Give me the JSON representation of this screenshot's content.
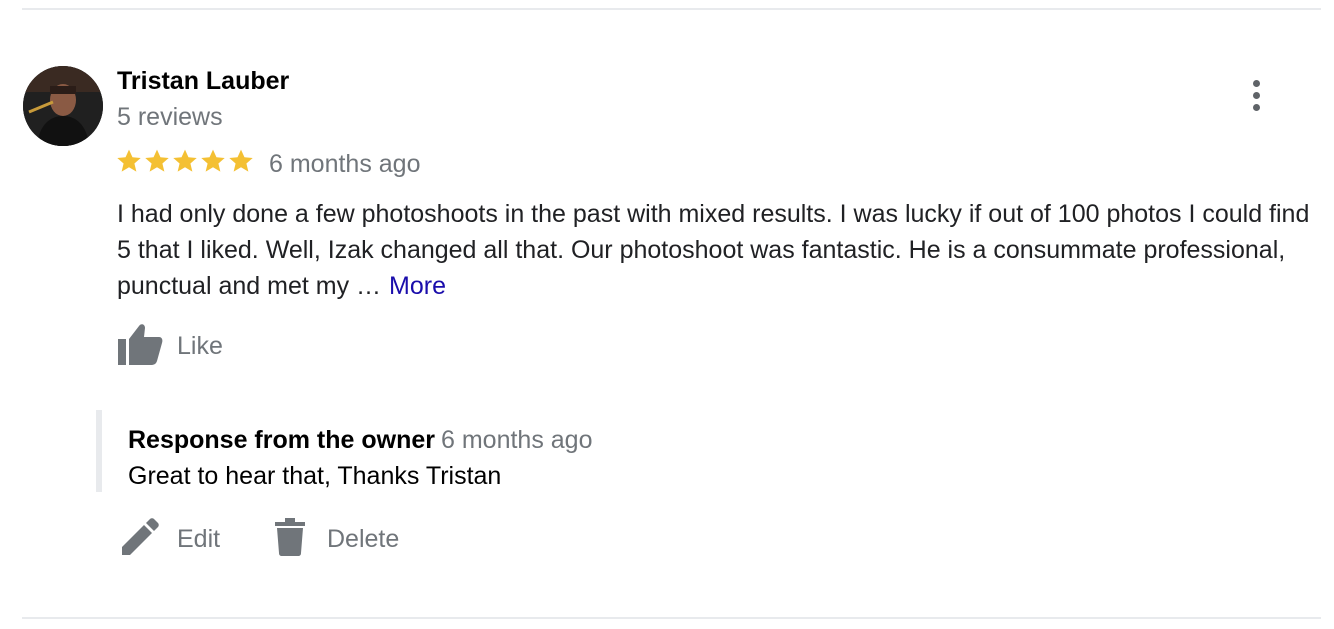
{
  "review": {
    "author_name": "Tristan Lauber",
    "author_reviews": "5 reviews",
    "rating": 5,
    "rating_max": 5,
    "date": "6 months ago",
    "text": "I had only done a few photoshoots in the past with mixed results. I was lucky if out of 100 photos I could find 5 that I liked. Well, Izak changed all that. Our photoshoot was fantastic. He is a consummate professional, punctual and met my …",
    "more_label": "More",
    "like_label": "Like",
    "star_color": "#f4c033"
  },
  "owner_response": {
    "title": "Response from the owner",
    "date": "6 months ago",
    "text": "Great to hear that, Thanks Tristan"
  },
  "actions": {
    "edit_label": "Edit",
    "delete_label": "Delete"
  },
  "icons": {
    "menu": "more-vert-icon",
    "like": "thumb-up-icon",
    "edit": "pencil-icon",
    "delete": "trash-icon",
    "star": "star-icon"
  }
}
